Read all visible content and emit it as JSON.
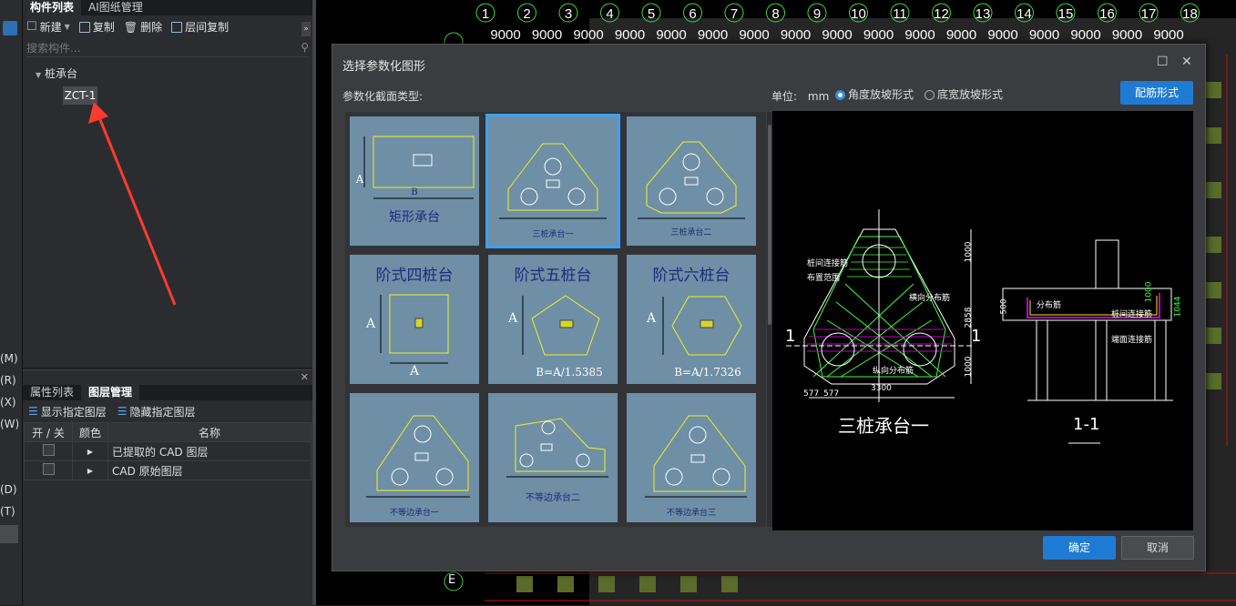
{
  "left_strip": {
    "letters": [
      "(M)",
      "(R)",
      "(X)",
      "(W)",
      "(D)",
      "(T)"
    ]
  },
  "component_panel": {
    "tabs": [
      "构件列表",
      "AI图纸管理"
    ],
    "toolbar": {
      "new": "新建",
      "copy": "复制",
      "delete": "删除",
      "floor_copy": "层间复制"
    },
    "search_placeholder": "搜索构件...",
    "tree": {
      "group": "桩承台",
      "item": "ZCT-1"
    }
  },
  "layer_panel": {
    "tabs": [
      "属性列表",
      "图层管理"
    ],
    "toolbar": {
      "show": "显示指定图层",
      "hide": "隐藏指定图层"
    },
    "columns": [
      "开 / 关",
      "颜色",
      "名称"
    ],
    "rows": [
      {
        "name": "已提取的 CAD 图层"
      },
      {
        "name": "CAD 原始图层"
      }
    ]
  },
  "cad": {
    "axis_numbers": [
      "1",
      "2",
      "3",
      "4",
      "5",
      "6",
      "7",
      "8",
      "9",
      "10",
      "11",
      "12",
      "13",
      "14",
      "15",
      "16",
      "17",
      "18"
    ],
    "span_label": "9000",
    "left_axes": [
      "E"
    ]
  },
  "dialog": {
    "title": "选择参数化图形",
    "section_label": "参数化截面类型:",
    "unit_label": "单位:",
    "unit_value": "mm",
    "radio_slope": "角度放坡形式",
    "radio_width": "底宽放坡形式",
    "rebar_button": "配筋形式",
    "ok_button": "确定",
    "cancel_button": "取消",
    "tiles": [
      {
        "name": "矩形承台",
        "label_a": "A",
        "label_b": "B"
      },
      {
        "name": "三桩承台一"
      },
      {
        "name": "三桩承台二"
      },
      {
        "name": "阶式四桩台",
        "label_a": "A"
      },
      {
        "name": "阶式五桩台",
        "label_a": "A",
        "formula": "B=A/1.5385"
      },
      {
        "name": "阶式六桩台",
        "label_a": "A",
        "formula": "B=A/1.7326"
      },
      {
        "name": "不等边承台一"
      },
      {
        "name": "不等边承台二"
      },
      {
        "name": "不等边承台三"
      }
    ],
    "preview": {
      "title": "三桩承台一",
      "section_title": "1-1",
      "section_mark": "1",
      "dims": [
        "1000",
        "2858",
        "1000",
        "3300",
        "577",
        "577",
        "500",
        "1044",
        "1000"
      ],
      "notes": [
        "桩间连接筋",
        "布置范围",
        "横向分布筋",
        "纵向分布筋",
        "分布筋",
        "桩间连接筋",
        "端面连接筋"
      ]
    }
  },
  "colors": {
    "accent": "#1e7bd4",
    "tile": "#6e8fa6",
    "drawing_green": "#3cff3c",
    "drawing_magenta": "#c000c0"
  }
}
